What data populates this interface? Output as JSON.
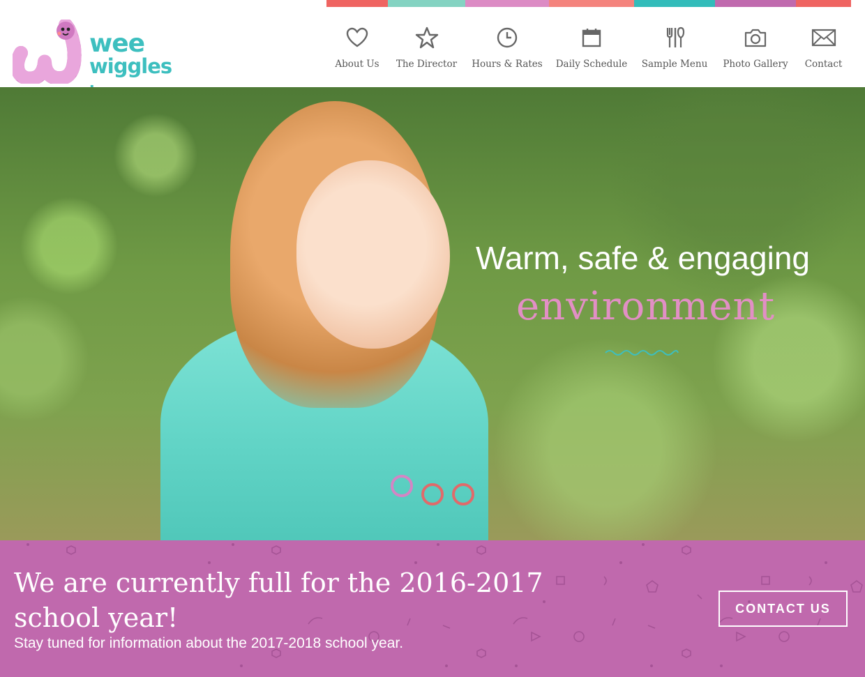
{
  "colors": {
    "stripe": [
      "#ef6461",
      "#84d3c2",
      "#dc8bc4",
      "#f4837d",
      "#32bcba",
      "#c06aae",
      "#ef6461"
    ],
    "teal": "#3dbfbf",
    "pink": "#e28fc5",
    "banner": "#c069ad",
    "dot": "#e16a6a"
  },
  "logo": {
    "line1": "wee",
    "line2": "wiggles",
    "line3": "inc."
  },
  "nav": [
    {
      "label": "About Us",
      "icon": "heart-icon"
    },
    {
      "label": "The Director",
      "icon": "star-icon"
    },
    {
      "label": "Hours & Rates",
      "icon": "clock-icon"
    },
    {
      "label": "Daily Schedule",
      "icon": "calendar-icon"
    },
    {
      "label": "Sample Menu",
      "icon": "utensils-icon"
    },
    {
      "label": "Photo Gallery",
      "icon": "camera-icon"
    },
    {
      "label": "Contact",
      "icon": "envelope-icon"
    }
  ],
  "hero": {
    "line1": "Warm, safe & engaging",
    "line2": "environment",
    "slides": 3,
    "active_slide": 1
  },
  "banner": {
    "title": "We are currently full for the 2016-2017 school year!",
    "subtitle": "Stay tuned for information about the 2017-2018 school year.",
    "button": "CONTACT US"
  }
}
